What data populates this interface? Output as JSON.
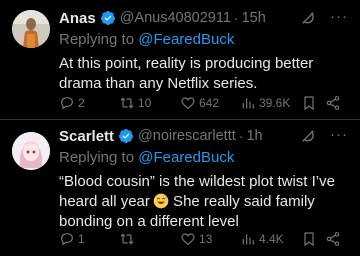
{
  "colors": {
    "background": "#000000",
    "text": "#e7e9ea",
    "muted": "#71767b",
    "accent": "#1d9bf0",
    "verified": "#1d9bf0"
  },
  "replying_to_label": "Replying to",
  "tweets": [
    {
      "name": "Anas",
      "handle": "@Anus40802911",
      "time": "15h",
      "reply_to": "@FearedBuck",
      "text": "At this point, reality is producing better drama than any Netflix series.",
      "emoji": "",
      "text_after_emoji": "",
      "more": "···",
      "counts": {
        "replies": "2",
        "retweets": "10",
        "likes": "642",
        "views": "39.6K"
      },
      "icons": [
        "reply-icon",
        "retweet-icon",
        "like-icon",
        "views-icon",
        "bookmark-icon",
        "share-icon",
        "grok-icon",
        "verified-badge-icon"
      ]
    },
    {
      "name": "Scarlett",
      "handle": "@noirescarlettt",
      "time": "1h",
      "reply_to": "@FearedBuck",
      "text": "“Blood cousin” is the wildest plot twist I’ve heard all year",
      "emoji": "sweat-smile-emoji",
      "text_after_emoji": " She really said family bonding on a different level",
      "more": "···",
      "counts": {
        "replies": "1",
        "retweets": "",
        "likes": "13",
        "views": "4.4K"
      },
      "icons": [
        "reply-icon",
        "retweet-icon",
        "like-icon",
        "views-icon",
        "bookmark-icon",
        "share-icon",
        "grok-icon",
        "verified-badge-icon"
      ]
    }
  ]
}
